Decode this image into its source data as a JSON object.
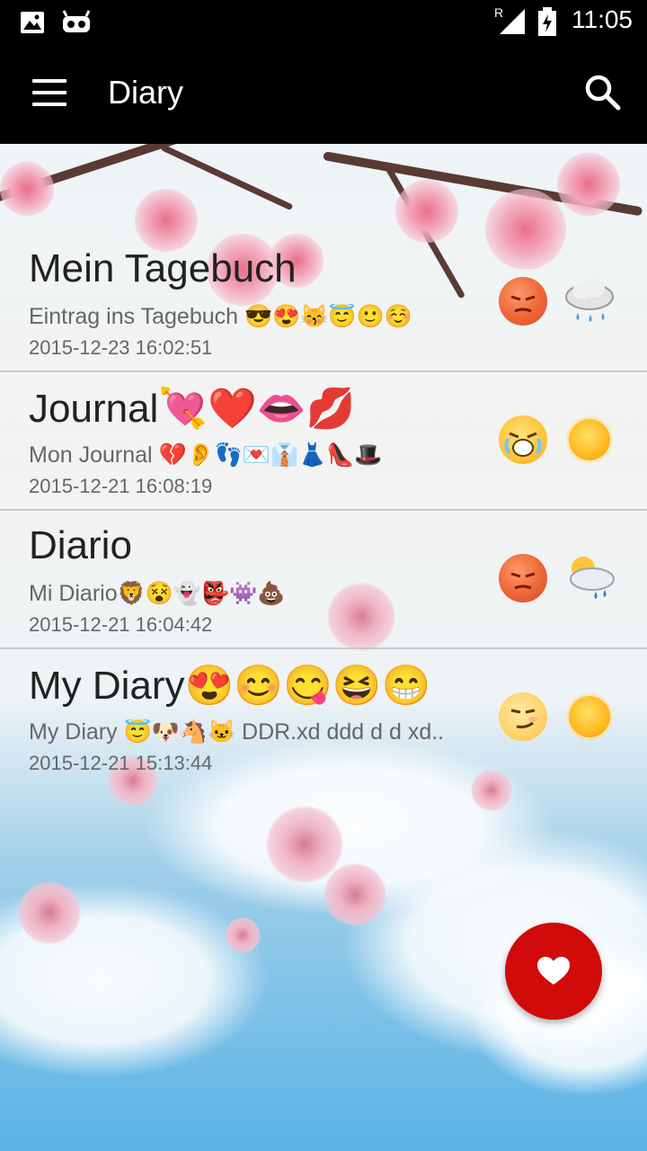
{
  "status_bar": {
    "time": "11:05",
    "network_label": "R"
  },
  "app_bar": {
    "title": "Diary"
  },
  "entries": [
    {
      "title": "Mein Tagebuch",
      "title_emoji": "",
      "subtitle": "Eintrag ins Tagebuch 😎😍😽😇🙂☺️",
      "date": "2015-12-23 16:02:51",
      "mood": "angry",
      "weather": "rain"
    },
    {
      "title": "Journal",
      "title_emoji": "💘❤️👄💋",
      "subtitle": "Mon Journal 💔👂👣💌👔👗👠🎩",
      "date": "2015-12-21 16:08:19",
      "mood": "crying",
      "weather": "sunny"
    },
    {
      "title": "Diario",
      "title_emoji": "",
      "subtitle": "Mi Diario🦁😵👻👺👾💩",
      "date": "2015-12-21 16:04:42",
      "mood": "angry",
      "weather": "partly-cloudy-rain"
    },
    {
      "title": "My Diary",
      "title_emoji": "😍😊😋😆😁",
      "subtitle": "My Diary 😇🐶🐴🐱 DDR.xd ddd d d xd..",
      "date": "2015-12-21 15:13:44",
      "mood": "smirk",
      "weather": "sunny"
    }
  ],
  "fab": {
    "icon": "heart-icon"
  },
  "colors": {
    "app_bar": "#000000",
    "fab": "#d10a0a",
    "title_text": "#222222",
    "secondary_text": "#666666"
  }
}
